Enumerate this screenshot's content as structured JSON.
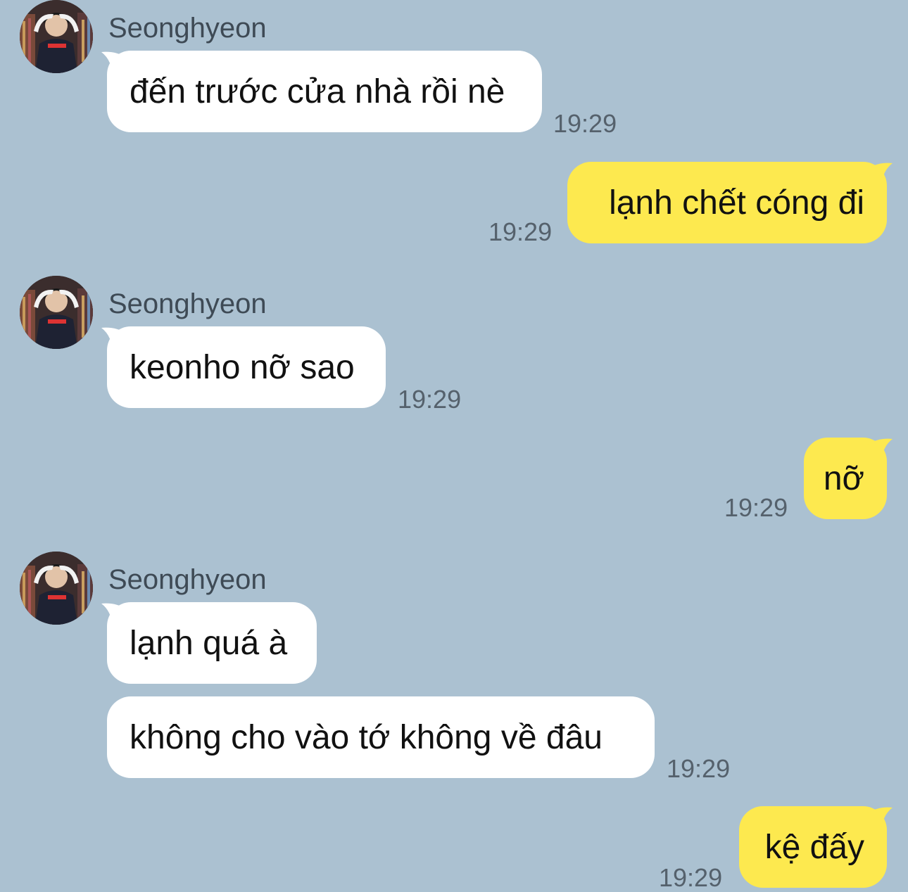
{
  "chat": {
    "contact_name": "Seonghyeon",
    "messages": [
      {
        "dir": "in",
        "text": "đến trước cửa nhà rồi nè",
        "time": "19:29"
      },
      {
        "dir": "out",
        "text": "lạnh chết cóng đi",
        "time": "19:29"
      },
      {
        "dir": "in",
        "text": "keonho nỡ sao",
        "time": "19:29"
      },
      {
        "dir": "out",
        "text": "nỡ",
        "time": "19:29"
      },
      {
        "dir": "in",
        "text": "lạnh quá à",
        "time": ""
      },
      {
        "dir": "in",
        "text": "không cho vào tớ không về đâu",
        "time": "19:29"
      },
      {
        "dir": "out",
        "text": "kệ đấy",
        "time": "19:29"
      }
    ]
  },
  "colors": {
    "background": "#abc1d1",
    "incoming_bubble": "#ffffff",
    "outgoing_bubble": "#fde94f",
    "text": "#111111",
    "timestamp": "#55616c"
  },
  "icons": {
    "avatar": "avatar-photo"
  }
}
